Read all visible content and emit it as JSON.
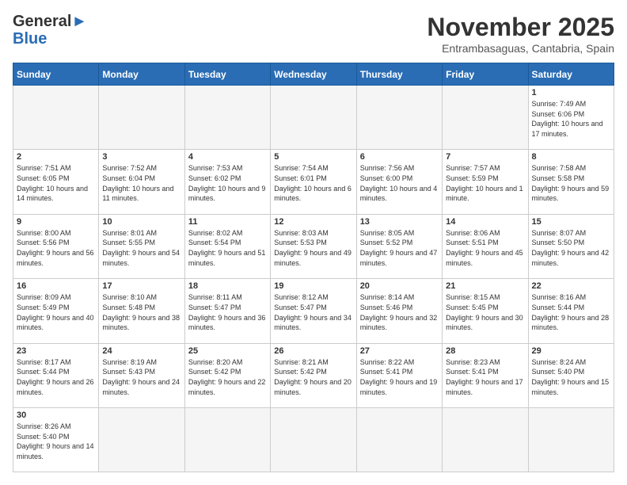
{
  "logo": {
    "line1": "General",
    "line2": "Blue"
  },
  "header": {
    "month": "November 2025",
    "location": "Entrambasaguas, Cantabria, Spain"
  },
  "weekdays": [
    "Sunday",
    "Monday",
    "Tuesday",
    "Wednesday",
    "Thursday",
    "Friday",
    "Saturday"
  ],
  "days": {
    "1": {
      "sunrise": "7:49 AM",
      "sunset": "6:06 PM",
      "daylight": "10 hours and 17 minutes."
    },
    "2": {
      "sunrise": "7:51 AM",
      "sunset": "6:05 PM",
      "daylight": "10 hours and 14 minutes."
    },
    "3": {
      "sunrise": "7:52 AM",
      "sunset": "6:04 PM",
      "daylight": "10 hours and 11 minutes."
    },
    "4": {
      "sunrise": "7:53 AM",
      "sunset": "6:02 PM",
      "daylight": "10 hours and 9 minutes."
    },
    "5": {
      "sunrise": "7:54 AM",
      "sunset": "6:01 PM",
      "daylight": "10 hours and 6 minutes."
    },
    "6": {
      "sunrise": "7:56 AM",
      "sunset": "6:00 PM",
      "daylight": "10 hours and 4 minutes."
    },
    "7": {
      "sunrise": "7:57 AM",
      "sunset": "5:59 PM",
      "daylight": "10 hours and 1 minute."
    },
    "8": {
      "sunrise": "7:58 AM",
      "sunset": "5:58 PM",
      "daylight": "9 hours and 59 minutes."
    },
    "9": {
      "sunrise": "8:00 AM",
      "sunset": "5:56 PM",
      "daylight": "9 hours and 56 minutes."
    },
    "10": {
      "sunrise": "8:01 AM",
      "sunset": "5:55 PM",
      "daylight": "9 hours and 54 minutes."
    },
    "11": {
      "sunrise": "8:02 AM",
      "sunset": "5:54 PM",
      "daylight": "9 hours and 51 minutes."
    },
    "12": {
      "sunrise": "8:03 AM",
      "sunset": "5:53 PM",
      "daylight": "9 hours and 49 minutes."
    },
    "13": {
      "sunrise": "8:05 AM",
      "sunset": "5:52 PM",
      "daylight": "9 hours and 47 minutes."
    },
    "14": {
      "sunrise": "8:06 AM",
      "sunset": "5:51 PM",
      "daylight": "9 hours and 45 minutes."
    },
    "15": {
      "sunrise": "8:07 AM",
      "sunset": "5:50 PM",
      "daylight": "9 hours and 42 minutes."
    },
    "16": {
      "sunrise": "8:09 AM",
      "sunset": "5:49 PM",
      "daylight": "9 hours and 40 minutes."
    },
    "17": {
      "sunrise": "8:10 AM",
      "sunset": "5:48 PM",
      "daylight": "9 hours and 38 minutes."
    },
    "18": {
      "sunrise": "8:11 AM",
      "sunset": "5:47 PM",
      "daylight": "9 hours and 36 minutes."
    },
    "19": {
      "sunrise": "8:12 AM",
      "sunset": "5:47 PM",
      "daylight": "9 hours and 34 minutes."
    },
    "20": {
      "sunrise": "8:14 AM",
      "sunset": "5:46 PM",
      "daylight": "9 hours and 32 minutes."
    },
    "21": {
      "sunrise": "8:15 AM",
      "sunset": "5:45 PM",
      "daylight": "9 hours and 30 minutes."
    },
    "22": {
      "sunrise": "8:16 AM",
      "sunset": "5:44 PM",
      "daylight": "9 hours and 28 minutes."
    },
    "23": {
      "sunrise": "8:17 AM",
      "sunset": "5:44 PM",
      "daylight": "9 hours and 26 minutes."
    },
    "24": {
      "sunrise": "8:19 AM",
      "sunset": "5:43 PM",
      "daylight": "9 hours and 24 minutes."
    },
    "25": {
      "sunrise": "8:20 AM",
      "sunset": "5:42 PM",
      "daylight": "9 hours and 22 minutes."
    },
    "26": {
      "sunrise": "8:21 AM",
      "sunset": "5:42 PM",
      "daylight": "9 hours and 20 minutes."
    },
    "27": {
      "sunrise": "8:22 AM",
      "sunset": "5:41 PM",
      "daylight": "9 hours and 19 minutes."
    },
    "28": {
      "sunrise": "8:23 AM",
      "sunset": "5:41 PM",
      "daylight": "9 hours and 17 minutes."
    },
    "29": {
      "sunrise": "8:24 AM",
      "sunset": "5:40 PM",
      "daylight": "9 hours and 15 minutes."
    },
    "30": {
      "sunrise": "8:26 AM",
      "sunset": "5:40 PM",
      "daylight": "9 hours and 14 minutes."
    }
  }
}
